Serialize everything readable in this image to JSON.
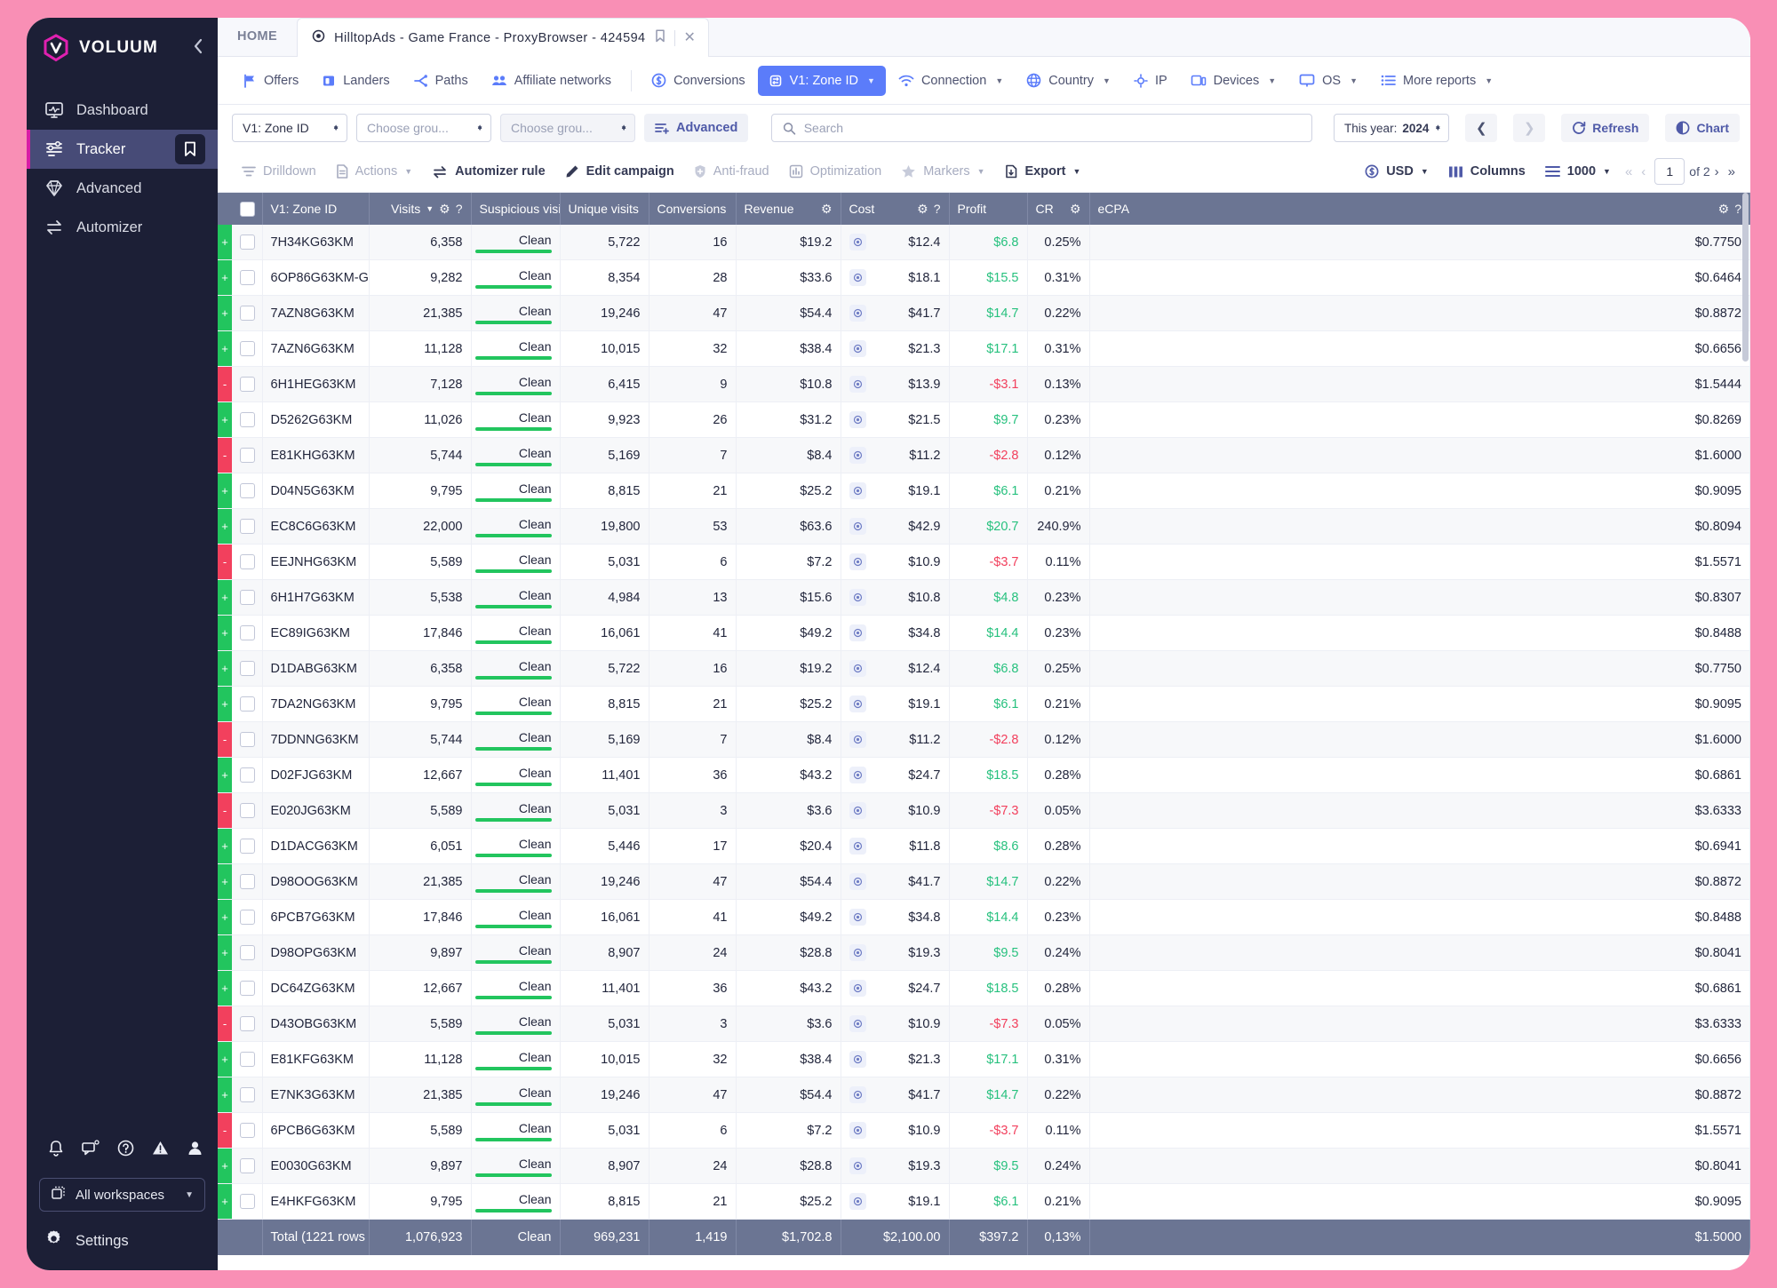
{
  "brand": {
    "name": "VOLUUM",
    "collapse_icon": "chevron-left"
  },
  "sidebar": {
    "items": [
      {
        "label": "Dashboard",
        "icon": "dashboard-icon",
        "active": false
      },
      {
        "label": "Tracker",
        "icon": "tracker-icon",
        "active": true
      },
      {
        "label": "Advanced",
        "icon": "diamond-icon",
        "active": false
      },
      {
        "label": "Automizer",
        "icon": "automizer-icon",
        "active": false
      }
    ],
    "bottom_icons": [
      "bell-icon",
      "chat-icon",
      "help-icon",
      "warning-icon",
      "user-icon"
    ],
    "workspace": "All workspaces",
    "settings": "Settings"
  },
  "tabs": {
    "home": "HOME",
    "active_title": "HilltopAds - Game France - ProxyBrowser - 424594"
  },
  "report_bar": {
    "items": [
      {
        "label": "Offers",
        "icon": "flag-icon",
        "selected": false,
        "caret": false
      },
      {
        "label": "Landers",
        "icon": "lander-icon",
        "selected": false,
        "caret": false
      },
      {
        "label": "Paths",
        "icon": "paths-icon",
        "selected": false,
        "caret": false
      },
      {
        "label": "Affiliate networks",
        "icon": "people-icon",
        "selected": false,
        "caret": false
      },
      {
        "label": "Conversions",
        "icon": "dollar-circle-icon",
        "selected": false,
        "caret": false
      },
      {
        "label": "V1: Zone ID",
        "icon": "variable-icon",
        "selected": true,
        "caret": true
      },
      {
        "label": "Connection",
        "icon": "wifi-icon",
        "selected": false,
        "caret": true
      },
      {
        "label": "Country",
        "icon": "globe-icon",
        "selected": false,
        "caret": true
      },
      {
        "label": "IP",
        "icon": "target-small-icon",
        "selected": false,
        "caret": false
      },
      {
        "label": "Devices",
        "icon": "device-icon",
        "selected": false,
        "caret": true
      },
      {
        "label": "OS",
        "icon": "monitor-icon",
        "selected": false,
        "caret": true
      },
      {
        "label": "More reports",
        "icon": "list-icon",
        "selected": false,
        "caret": true
      }
    ]
  },
  "filter_bar": {
    "group1": "V1: Zone ID",
    "group2": "Choose grou...",
    "group3": "Choose grou...",
    "advanced": "Advanced",
    "search_placeholder": "Search",
    "search_value": "",
    "date_label": "This year:",
    "date_value": "2024",
    "refresh": "Refresh",
    "chart": "Chart"
  },
  "action_bar": {
    "drilldown": "Drilldown",
    "actions": "Actions",
    "automizer_rule": "Automizer rule",
    "edit_campaign": "Edit campaign",
    "anti_fraud": "Anti-fraud",
    "optimization": "Optimization",
    "markers": "Markers",
    "export": "Export",
    "currency": "USD",
    "columns": "Columns",
    "rows_per_page": "1000",
    "page_current": "1",
    "page_of": "of 2"
  },
  "table": {
    "headers": {
      "zone": "V1: Zone ID",
      "visits": "Visits",
      "suspicious": "Suspicious visit",
      "unique": "Unique visits",
      "conversions": "Conversions",
      "revenue": "Revenue",
      "cost": "Cost",
      "profit": "Profit",
      "cr": "CR",
      "ecpa": "eCPA"
    },
    "rows": [
      {
        "flag": "+",
        "zone": "7H34KG63KM",
        "visits": "6,358",
        "susp": "Clean",
        "unique": "5,722",
        "conv": "16",
        "revenue": "$19.2",
        "cost": "$12.4",
        "profit": "$6.8",
        "profit_pos": true,
        "cr": "0.25%",
        "ecpa": "$0.7750"
      },
      {
        "flag": "+",
        "zone": "6OP86G63KM-G",
        "visits": "9,282",
        "susp": "Clean",
        "unique": "8,354",
        "conv": "28",
        "revenue": "$33.6",
        "cost": "$18.1",
        "profit": "$15.5",
        "profit_pos": true,
        "cr": "0.31%",
        "ecpa": "$0.6464"
      },
      {
        "flag": "+",
        "zone": "7AZN8G63KM",
        "visits": "21,385",
        "susp": "Clean",
        "unique": "19,246",
        "conv": "47",
        "revenue": "$54.4",
        "cost": "$41.7",
        "profit": "$14.7",
        "profit_pos": true,
        "cr": "0.22%",
        "ecpa": "$0.8872"
      },
      {
        "flag": "+",
        "zone": "7AZN6G63KM",
        "visits": "11,128",
        "susp": "Clean",
        "unique": "10,015",
        "conv": "32",
        "revenue": "$38.4",
        "cost": "$21.3",
        "profit": "$17.1",
        "profit_pos": true,
        "cr": "0.31%",
        "ecpa": "$0.6656"
      },
      {
        "flag": "-",
        "zone": "6H1HEG63KM",
        "visits": "7,128",
        "susp": "Clean",
        "unique": "6,415",
        "conv": "9",
        "revenue": "$10.8",
        "cost": "$13.9",
        "profit": "-$3.1",
        "profit_pos": false,
        "cr": "0.13%",
        "ecpa": "$1.5444"
      },
      {
        "flag": "+",
        "zone": "D5262G63KM",
        "visits": "11,026",
        "susp": "Clean",
        "unique": "9,923",
        "conv": "26",
        "revenue": "$31.2",
        "cost": "$21.5",
        "profit": "$9.7",
        "profit_pos": true,
        "cr": "0.23%",
        "ecpa": "$0.8269"
      },
      {
        "flag": "-",
        "zone": "E81KHG63KM",
        "visits": "5,744",
        "susp": "Clean",
        "unique": "5,169",
        "conv": "7",
        "revenue": "$8.4",
        "cost": "$11.2",
        "profit": "-$2.8",
        "profit_pos": false,
        "cr": "0.12%",
        "ecpa": "$1.6000"
      },
      {
        "flag": "+",
        "zone": "D04N5G63KM",
        "visits": "9,795",
        "susp": "Clean",
        "unique": "8,815",
        "conv": "21",
        "revenue": "$25.2",
        "cost": "$19.1",
        "profit": "$6.1",
        "profit_pos": true,
        "cr": "0.21%",
        "ecpa": "$0.9095"
      },
      {
        "flag": "+",
        "zone": "EC8C6G63KM",
        "visits": "22,000",
        "susp": "Clean",
        "unique": "19,800",
        "conv": "53",
        "revenue": "$63.6",
        "cost": "$42.9",
        "profit": "$20.7",
        "profit_pos": true,
        "cr": "240.9%",
        "ecpa": "$0.8094"
      },
      {
        "flag": "-",
        "zone": "EEJNHG63KM",
        "visits": "5,589",
        "susp": "Clean",
        "unique": "5,031",
        "conv": "6",
        "revenue": "$7.2",
        "cost": "$10.9",
        "profit": "-$3.7",
        "profit_pos": false,
        "cr": "0.11%",
        "ecpa": "$1.5571"
      },
      {
        "flag": "+",
        "zone": "6H1H7G63KM",
        "visits": "5,538",
        "susp": "Clean",
        "unique": "4,984",
        "conv": "13",
        "revenue": "$15.6",
        "cost": "$10.8",
        "profit": "$4.8",
        "profit_pos": true,
        "cr": "0.23%",
        "ecpa": "$0.8307"
      },
      {
        "flag": "+",
        "zone": "EC89IG63KM",
        "visits": "17,846",
        "susp": "Clean",
        "unique": "16,061",
        "conv": "41",
        "revenue": "$49.2",
        "cost": "$34.8",
        "profit": "$14.4",
        "profit_pos": true,
        "cr": "0.23%",
        "ecpa": "$0.8488"
      },
      {
        "flag": "+",
        "zone": "D1DABG63KM",
        "visits": "6,358",
        "susp": "Clean",
        "unique": "5,722",
        "conv": "16",
        "revenue": "$19.2",
        "cost": "$12.4",
        "profit": "$6.8",
        "profit_pos": true,
        "cr": "0.25%",
        "ecpa": "$0.7750"
      },
      {
        "flag": "+",
        "zone": "7DA2NG63KM",
        "visits": "9,795",
        "susp": "Clean",
        "unique": "8,815",
        "conv": "21",
        "revenue": "$25.2",
        "cost": "$19.1",
        "profit": "$6.1",
        "profit_pos": true,
        "cr": "0.21%",
        "ecpa": "$0.9095"
      },
      {
        "flag": "-",
        "zone": "7DDNNG63KM",
        "visits": "5,744",
        "susp": "Clean",
        "unique": "5,169",
        "conv": "7",
        "revenue": "$8.4",
        "cost": "$11.2",
        "profit": "-$2.8",
        "profit_pos": false,
        "cr": "0.12%",
        "ecpa": "$1.6000"
      },
      {
        "flag": "+",
        "zone": "D02FJG63KM",
        "visits": "12,667",
        "susp": "Clean",
        "unique": "11,401",
        "conv": "36",
        "revenue": "$43.2",
        "cost": "$24.7",
        "profit": "$18.5",
        "profit_pos": true,
        "cr": "0.28%",
        "ecpa": "$0.6861"
      },
      {
        "flag": "-",
        "zone": "E020JG63KM",
        "visits": "5,589",
        "susp": "Clean",
        "unique": "5,031",
        "conv": "3",
        "revenue": "$3.6",
        "cost": "$10.9",
        "profit": "-$7.3",
        "profit_pos": false,
        "cr": "0.05%",
        "ecpa": "$3.6333"
      },
      {
        "flag": "+",
        "zone": "D1DACG63KM",
        "visits": "6,051",
        "susp": "Clean",
        "unique": "5,446",
        "conv": "17",
        "revenue": "$20.4",
        "cost": "$11.8",
        "profit": "$8.6",
        "profit_pos": true,
        "cr": "0.28%",
        "ecpa": "$0.6941"
      },
      {
        "flag": "+",
        "zone": "D98OOG63KM",
        "visits": "21,385",
        "susp": "Clean",
        "unique": "19,246",
        "conv": "47",
        "revenue": "$54.4",
        "cost": "$41.7",
        "profit": "$14.7",
        "profit_pos": true,
        "cr": "0.22%",
        "ecpa": "$0.8872"
      },
      {
        "flag": "+",
        "zone": "6PCB7G63KM",
        "visits": "17,846",
        "susp": "Clean",
        "unique": "16,061",
        "conv": "41",
        "revenue": "$49.2",
        "cost": "$34.8",
        "profit": "$14.4",
        "profit_pos": true,
        "cr": "0.23%",
        "ecpa": "$0.8488"
      },
      {
        "flag": "+",
        "zone": "D98OPG63KM",
        "visits": "9,897",
        "susp": "Clean",
        "unique": "8,907",
        "conv": "24",
        "revenue": "$28.8",
        "cost": "$19.3",
        "profit": "$9.5",
        "profit_pos": true,
        "cr": "0.24%",
        "ecpa": "$0.8041"
      },
      {
        "flag": "+",
        "zone": "DC64ZG63KM",
        "visits": "12,667",
        "susp": "Clean",
        "unique": "11,401",
        "conv": "36",
        "revenue": "$43.2",
        "cost": "$24.7",
        "profit": "$18.5",
        "profit_pos": true,
        "cr": "0.28%",
        "ecpa": "$0.6861"
      },
      {
        "flag": "-",
        "zone": "D43OBG63KM",
        "visits": "5,589",
        "susp": "Clean",
        "unique": "5,031",
        "conv": "3",
        "revenue": "$3.6",
        "cost": "$10.9",
        "profit": "-$7.3",
        "profit_pos": false,
        "cr": "0.05%",
        "ecpa": "$3.6333"
      },
      {
        "flag": "+",
        "zone": "E81KFG63KM",
        "visits": "11,128",
        "susp": "Clean",
        "unique": "10,015",
        "conv": "32",
        "revenue": "$38.4",
        "cost": "$21.3",
        "profit": "$17.1",
        "profit_pos": true,
        "cr": "0.31%",
        "ecpa": "$0.6656"
      },
      {
        "flag": "+",
        "zone": "E7NK3G63KM",
        "visits": "21,385",
        "susp": "Clean",
        "unique": "19,246",
        "conv": "47",
        "revenue": "$54.4",
        "cost": "$41.7",
        "profit": "$14.7",
        "profit_pos": true,
        "cr": "0.22%",
        "ecpa": "$0.8872"
      },
      {
        "flag": "-",
        "zone": "6PCB6G63KM",
        "visits": "5,589",
        "susp": "Clean",
        "unique": "5,031",
        "conv": "6",
        "revenue": "$7.2",
        "cost": "$10.9",
        "profit": "-$3.7",
        "profit_pos": false,
        "cr": "0.11%",
        "ecpa": "$1.5571"
      },
      {
        "flag": "+",
        "zone": "E0030G63KM",
        "visits": "9,897",
        "susp": "Clean",
        "unique": "8,907",
        "conv": "24",
        "revenue": "$28.8",
        "cost": "$19.3",
        "profit": "$9.5",
        "profit_pos": true,
        "cr": "0.24%",
        "ecpa": "$0.8041"
      },
      {
        "flag": "+",
        "zone": "E4HKFG63KM",
        "visits": "9,795",
        "susp": "Clean",
        "unique": "8,815",
        "conv": "21",
        "revenue": "$25.2",
        "cost": "$19.1",
        "profit": "$6.1",
        "profit_pos": true,
        "cr": "0.21%",
        "ecpa": "$0.9095"
      }
    ],
    "total": {
      "label": "Total (1221 rows",
      "visits": "1,076,923",
      "susp": "Clean",
      "unique": "969,231",
      "conv": "1,419",
      "revenue": "$1,702.8",
      "cost": "$2,100.00",
      "profit": "$397.2",
      "cr": "0,13%",
      "ecpa": "$1.5000"
    }
  },
  "colors": {
    "accent": "#5B7CFA",
    "brand_pink": "#D81DA6",
    "positive": "#27C17E",
    "negative": "#F2405D",
    "header_bg": "#6B7593",
    "page_bg": "#F98FB5"
  }
}
